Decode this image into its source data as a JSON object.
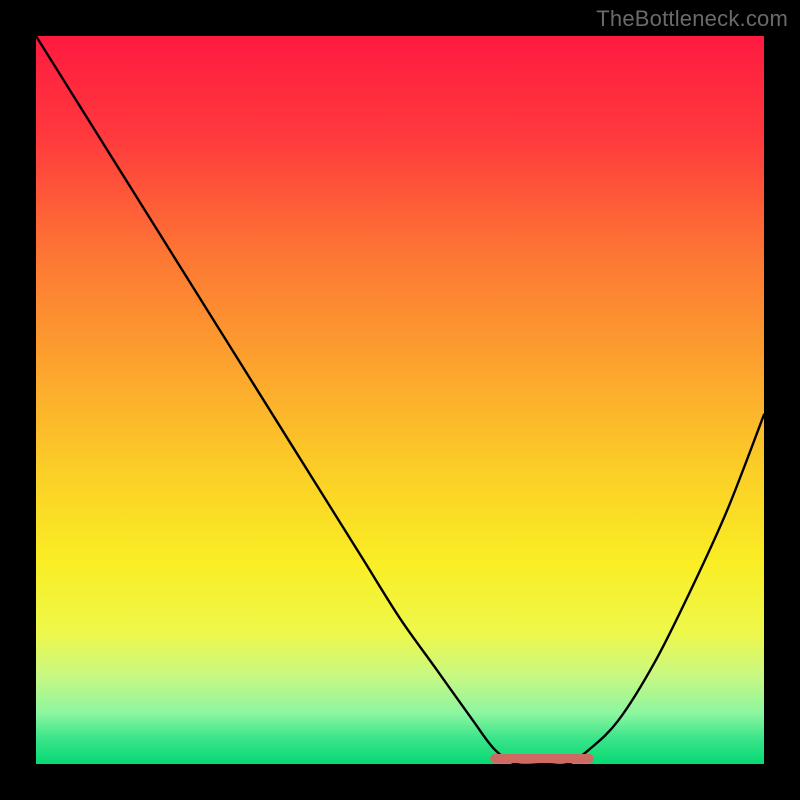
{
  "watermark": "TheBottleneck.com",
  "chart_data": {
    "type": "line",
    "title": "",
    "xlabel": "",
    "ylabel": "",
    "xlim": [
      0,
      100
    ],
    "ylim": [
      0,
      100
    ],
    "grid": false,
    "legend": false,
    "series": [
      {
        "name": "bottleneck-curve",
        "x": [
          0,
          5,
          10,
          15,
          20,
          25,
          30,
          35,
          40,
          45,
          50,
          55,
          60,
          63,
          66,
          70,
          73,
          76,
          80,
          85,
          90,
          95,
          100
        ],
        "y": [
          100,
          92,
          84,
          76,
          68,
          60,
          52,
          44,
          36,
          28,
          20,
          13,
          6,
          2,
          0,
          0,
          0,
          2,
          6,
          14,
          24,
          35,
          48
        ],
        "color": "#000000"
      },
      {
        "name": "optimal-zone",
        "x": [
          63,
          76
        ],
        "y": [
          0,
          0
        ],
        "color": "#cd6a62"
      }
    ],
    "background_gradient": {
      "stops": [
        {
          "offset": 0.0,
          "color": "#ff1a40"
        },
        {
          "offset": 0.14,
          "color": "#ff3a3d"
        },
        {
          "offset": 0.3,
          "color": "#fd7634"
        },
        {
          "offset": 0.45,
          "color": "#fca22e"
        },
        {
          "offset": 0.6,
          "color": "#fbcf27"
        },
        {
          "offset": 0.72,
          "color": "#faed24"
        },
        {
          "offset": 0.82,
          "color": "#eef84a"
        },
        {
          "offset": 0.88,
          "color": "#c7f884"
        },
        {
          "offset": 0.93,
          "color": "#8df6a0"
        },
        {
          "offset": 0.965,
          "color": "#3ae48a"
        },
        {
          "offset": 1.0,
          "color": "#06d973"
        }
      ]
    }
  }
}
